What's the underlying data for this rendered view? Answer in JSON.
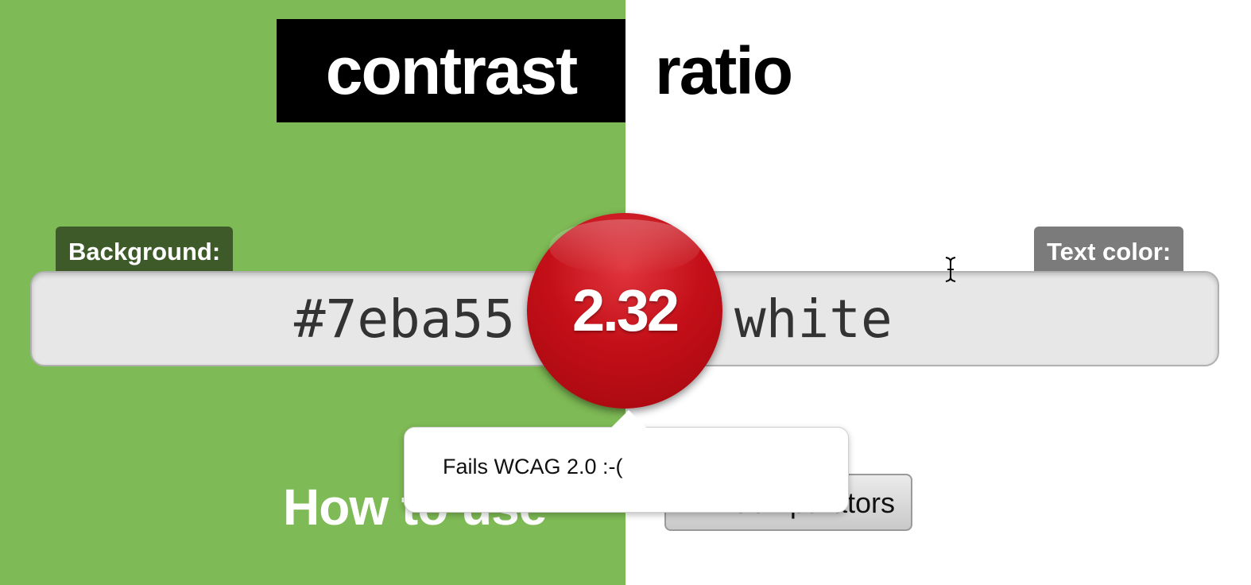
{
  "page": {
    "title_word_1": "contrast",
    "title_word_2": "ratio"
  },
  "background_field": {
    "label": "Background:",
    "value": "#7eba55"
  },
  "text_field": {
    "label": "Text color:",
    "value": "white"
  },
  "result": {
    "ratio": "2.32",
    "tooltip": "Fails WCAG 2.0 :-("
  },
  "links": {
    "how_to_use": "How to use",
    "comparators": "Comparators"
  },
  "colors": {
    "background_preview": "#7eba55",
    "text_preview": "#ffffff",
    "ratio_badge": "#c40f18"
  },
  "cursor": {
    "icon": "text-cursor-icon"
  }
}
